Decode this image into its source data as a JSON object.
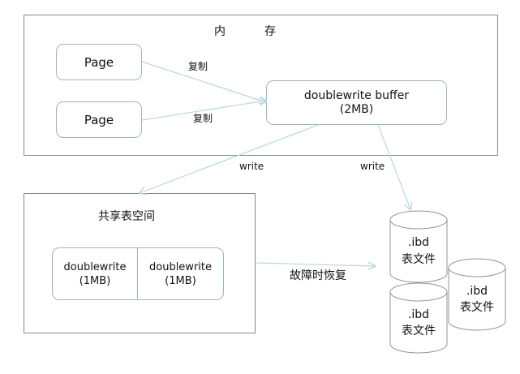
{
  "memory": {
    "title_left": "内",
    "title_right": "存",
    "page_top": "Page",
    "page_bottom": "Page",
    "copy_top": "复制",
    "copy_bottom": "复制",
    "buffer_line1": "doublewrite buffer",
    "buffer_line2": "(2MB)"
  },
  "writes": {
    "left": "write",
    "right": "write"
  },
  "shared": {
    "title": "共享表空间",
    "cell_left_line1": "doublewrite",
    "cell_left_line2": "(1MB)",
    "cell_right_line1": "doublewrite",
    "cell_right_line2": "(1MB)"
  },
  "recovery_label": "故障时恢复",
  "files": [
    {
      "line1": ".ibd",
      "line2": "表文件"
    },
    {
      "line1": ".ibd",
      "line2": "表文件"
    },
    {
      "line1": ".ibd",
      "line2": "表文件"
    }
  ],
  "colors": {
    "border": "#7f8c92",
    "rounded_border": "#9fb4bd",
    "arrow": "#b9d8e3"
  }
}
